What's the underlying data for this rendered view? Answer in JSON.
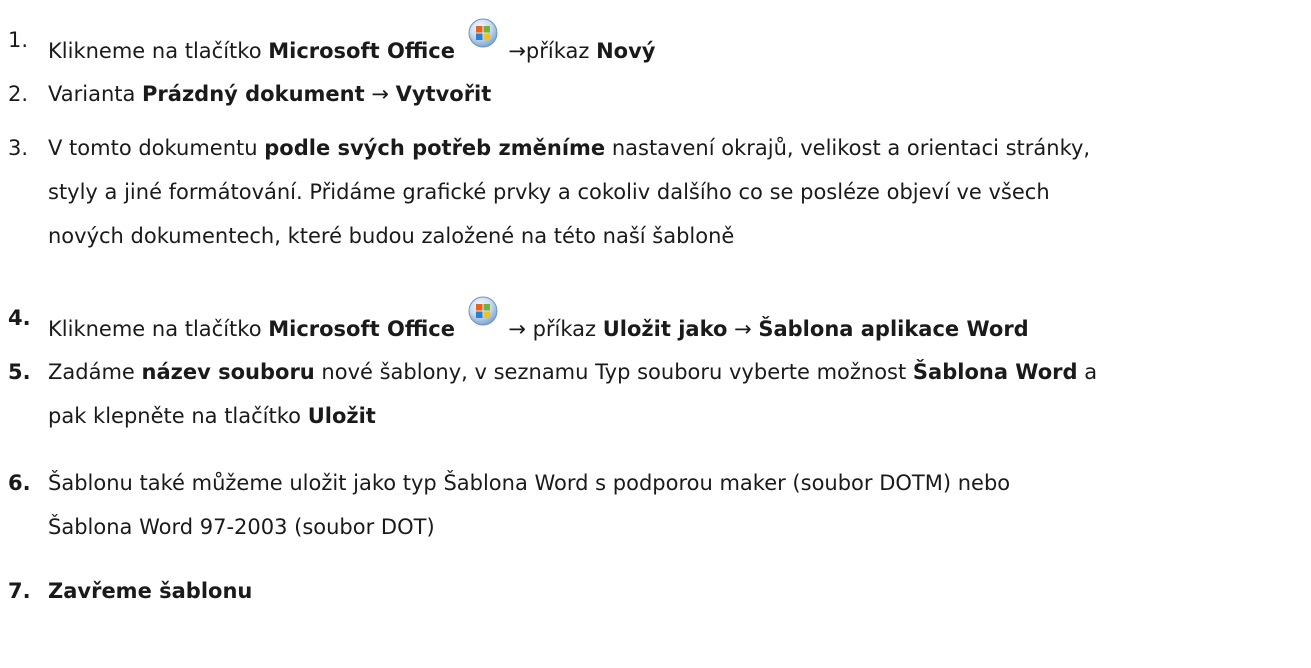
{
  "list": {
    "items": [
      {
        "number": "1.",
        "number_bold": false,
        "lines": [
          [
            {
              "t": "Klikneme na tlačítko "
            },
            {
              "t": "Microsoft Office",
              "b": true
            },
            {
              "icon": "microsoft-office-button-icon"
            },
            {
              "t": "→příkaz "
            },
            {
              "t": "Nový",
              "b": true
            }
          ]
        ]
      },
      {
        "number": "2.",
        "number_bold": false,
        "lines": [
          [
            {
              "t": "Varianta "
            },
            {
              "t": "Prázdný dokument",
              "b": true
            },
            {
              "t": " → "
            },
            {
              "t": "Vytvořit",
              "b": true
            }
          ]
        ]
      },
      {
        "number": "3.",
        "number_bold": false,
        "lines": [
          [
            {
              "t": "V tomto dokumentu "
            },
            {
              "t": "podle svých potřeb změníme",
              "b": true
            },
            {
              "t": " nastavení okrajů, velikost a orientaci stránky,"
            }
          ],
          [
            {
              "t": "styly a jiné formátování. Přidáme grafické prvky a cokoliv dalšího co se posléze objeví ve všech"
            }
          ],
          [
            {
              "t": "nových dokumentech, které budou založené na této naší šabloně"
            }
          ]
        ]
      },
      {
        "number": "4.",
        "number_bold": true,
        "lines": [
          [
            {
              "t": "Klikneme na tlačítko "
            },
            {
              "t": "Microsoft Office",
              "b": true
            },
            {
              "icon": "microsoft-office-button-icon"
            },
            {
              "t": " → příkaz "
            },
            {
              "t": "Uložit jako",
              "b": true
            },
            {
              "t": " → "
            },
            {
              "t": "Šablona aplikace Word",
              "b": true
            }
          ]
        ]
      },
      {
        "number": "5.",
        "number_bold": true,
        "lines": [
          [
            {
              "t": "Zadáme "
            },
            {
              "t": "název souboru",
              "b": true
            },
            {
              "t": " nové šablony, v seznamu Typ souboru vyberte možnost "
            },
            {
              "t": "Šablona Word",
              "b": true
            },
            {
              "t": " a"
            }
          ],
          [
            {
              "t": "pak klepněte na tlačítko "
            },
            {
              "t": "Uložit",
              "b": true
            }
          ]
        ]
      },
      {
        "number": "6.",
        "number_bold": true,
        "lines": [
          [
            {
              "t": "Šablonu také můžeme uložit jako typ Šablona Word s podporou maker (soubor DOTM) nebo"
            }
          ],
          [
            {
              "t": "Šablona Word 97-2003 (soubor DOT)"
            }
          ]
        ]
      },
      {
        "number": "7.",
        "number_bold": true,
        "lines": [
          [
            {
              "t": "Zavřeme šablonu",
              "b": true
            }
          ]
        ]
      }
    ]
  }
}
